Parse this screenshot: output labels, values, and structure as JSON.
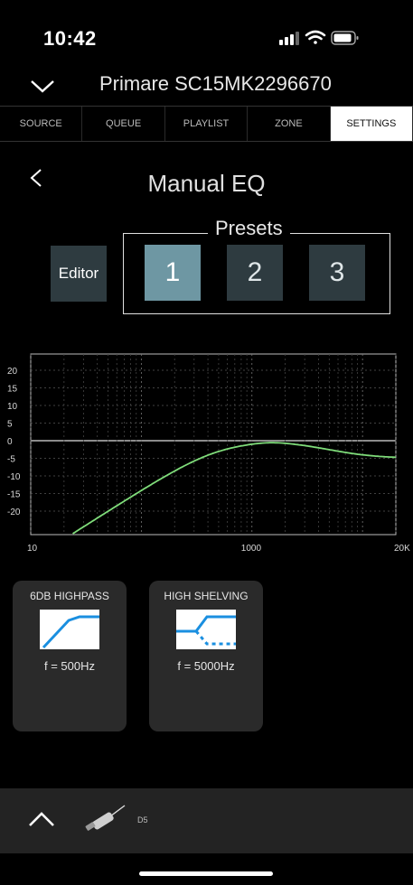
{
  "status_bar": {
    "time": "10:42"
  },
  "header": {
    "device_name": "Primare SC15MK2296670"
  },
  "tabs": [
    {
      "label": "SOURCE",
      "active": false
    },
    {
      "label": "QUEUE",
      "active": false
    },
    {
      "label": "PLAYLIST",
      "active": false
    },
    {
      "label": "ZONE",
      "active": false
    },
    {
      "label": "SETTINGS",
      "active": true
    }
  ],
  "page": {
    "title": "Manual EQ"
  },
  "presets": {
    "label": "Presets",
    "editor_label": "Editor",
    "items": [
      "1",
      "2",
      "3"
    ],
    "selected": "1"
  },
  "eq_graph": {
    "y_ticks": [
      "20",
      "15",
      "10",
      "5",
      "0",
      "-5",
      "-10",
      "-15",
      "-20"
    ],
    "x_ticks": [
      "10",
      "1000",
      "20K"
    ],
    "curve_color": "#7fdc7a"
  },
  "filters": [
    {
      "title": "6DB HIGHPASS",
      "freq": "f = 500Hz",
      "icon": "highpass-curve-icon"
    },
    {
      "title": "HIGH SHELVING",
      "freq": "f = 5000Hz",
      "icon": "high-shelving-curve-icon"
    }
  ],
  "bottom_bar": {
    "source_label": "D5"
  },
  "colors": {
    "accent": "#6e97a3",
    "preset_bg": "#2e3b40",
    "filter_line": "#1a8fe0"
  }
}
